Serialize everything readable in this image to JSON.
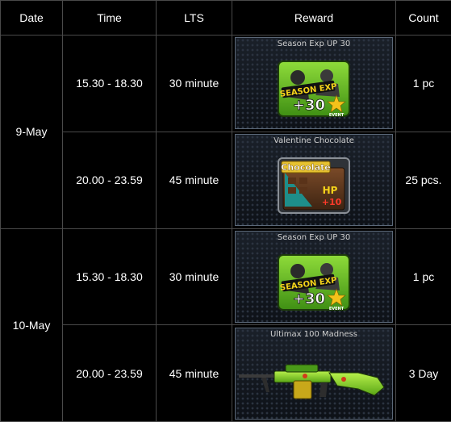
{
  "headers": {
    "date": "Date",
    "time": "Time",
    "lts": "LTS",
    "reward": "Reward",
    "count": "Count"
  },
  "days": [
    {
      "date": "9-May",
      "rows": [
        {
          "time": "15.30 - 18.30",
          "lts": "30 minute",
          "reward": "Season Exp UP 30",
          "reward_icon": "season-exp-icon",
          "count": "1 pc"
        },
        {
          "time": "20.00 - 23.59",
          "lts": "45 minute",
          "reward": "Valentine Chocolate",
          "reward_icon": "chocolate-icon",
          "count": "25 pcs."
        }
      ]
    },
    {
      "date": "10-May",
      "rows": [
        {
          "time": "15.30 - 18.30",
          "lts": "30 minute",
          "reward": "Season Exp UP 30",
          "reward_icon": "season-exp-icon",
          "count": "1 pc"
        },
        {
          "time": "20.00 - 23.59",
          "lts": "45 minute",
          "reward": "Ultimax 100 Madness",
          "reward_icon": "machine-gun-icon",
          "count": "3 Day"
        }
      ]
    }
  ],
  "art_text": {
    "season_exp": {
      "title": "SEASON EXP",
      "value": "+30",
      "tag": "EVENT"
    },
    "chocolate": {
      "title": "Chocolate",
      "stat": "HP",
      "value": "+10"
    }
  },
  "colors": {
    "background": "#000000",
    "border": "#4a4a4a",
    "text": "#ffffff",
    "accent_green": "#58b81e",
    "exp_yellow": "#f4d21a"
  }
}
